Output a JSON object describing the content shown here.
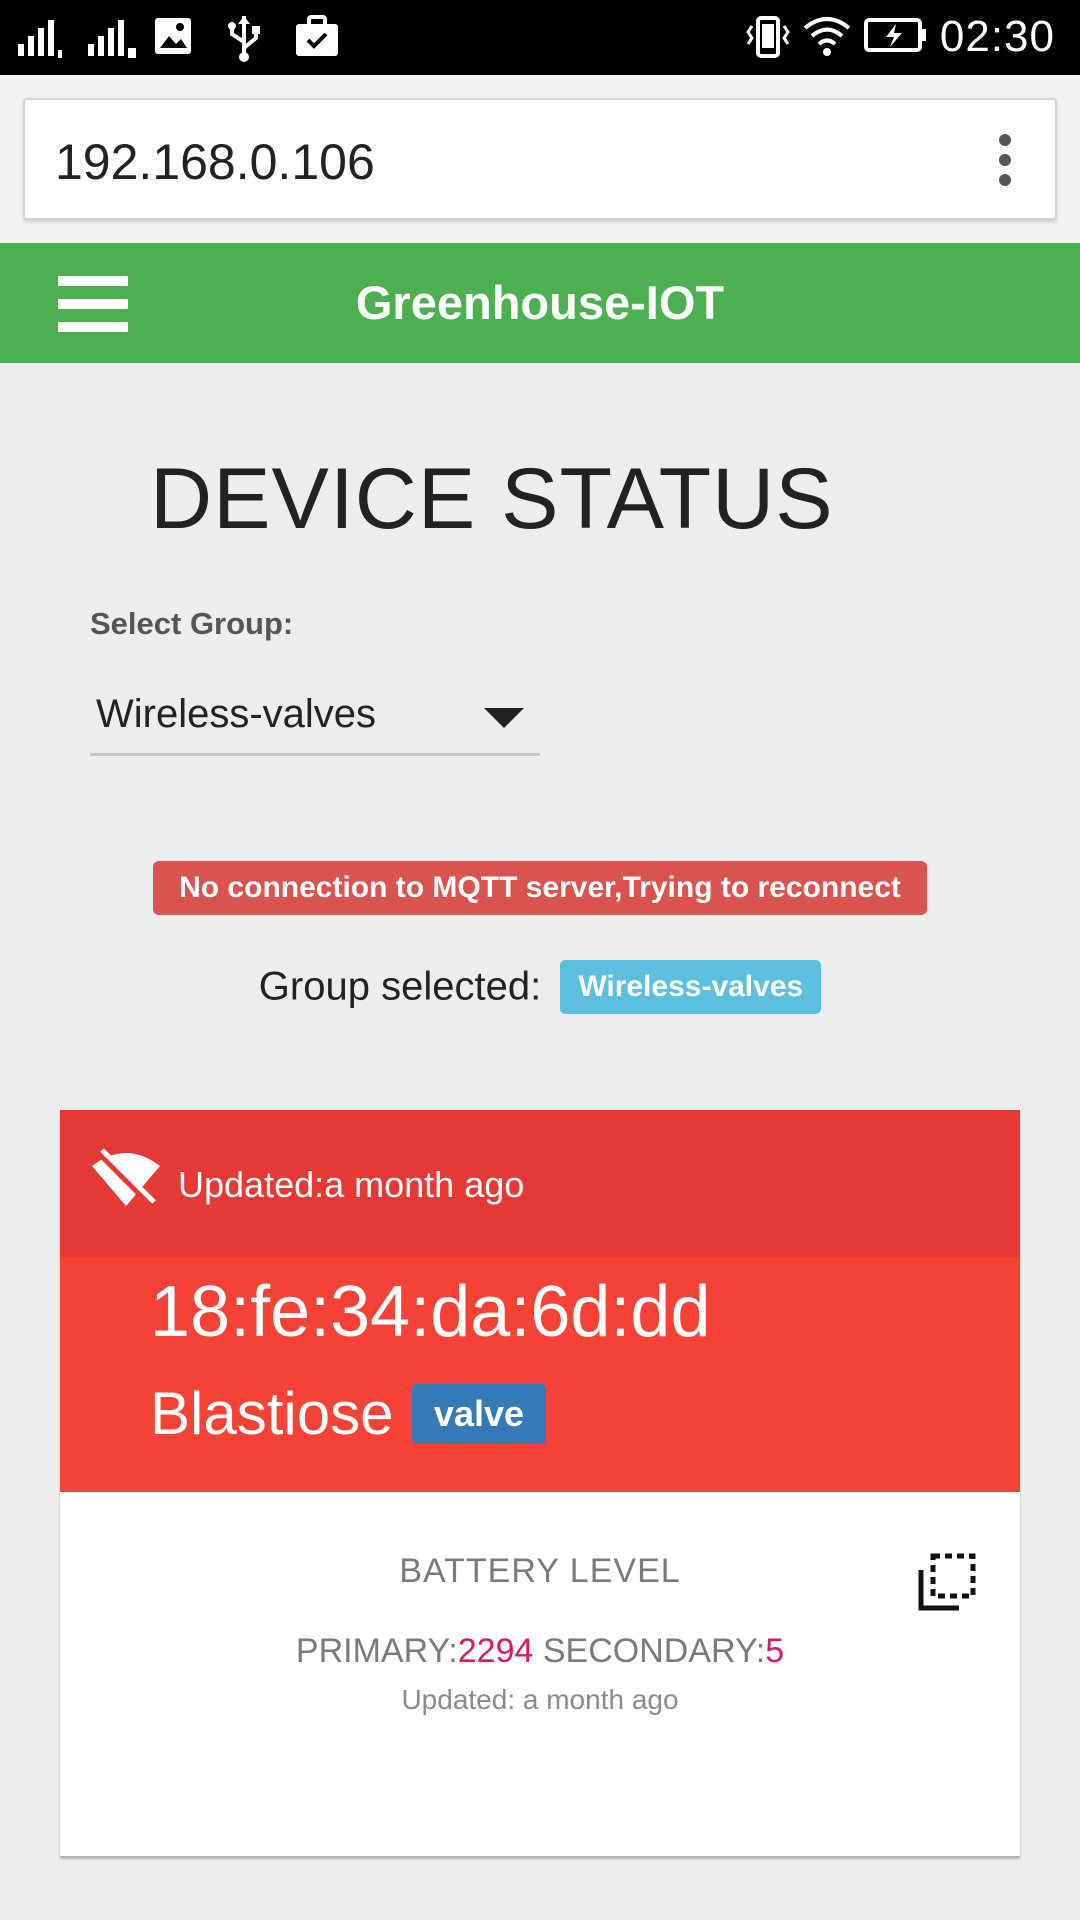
{
  "status_bar": {
    "time": "02:30",
    "icons": [
      "signal-1-icon",
      "signal-2-icon",
      "image-icon",
      "usb-icon",
      "briefcase-check-icon",
      "vibrate-icon",
      "wifi-icon",
      "battery-charging-icon"
    ]
  },
  "browser": {
    "url": "192.168.0.106",
    "menu_icon": "more-vert-icon"
  },
  "app_nav": {
    "title": "Greenhouse-IOT",
    "menu_icon": "hamburger-menu-icon",
    "color": "#4caf50"
  },
  "main": {
    "title": "DEVICE STATUS",
    "select_label": "Select Group:",
    "select_value": "Wireless-valves",
    "alert": "No connection to MQTT server,Trying to reconnect",
    "group_selected_label": "Group selected:",
    "group_selected_badge": "Wireless-valves"
  },
  "device_card": {
    "status_icon": "wifi-off-icon",
    "updated": "Updated:a month ago",
    "mac": "18:fe:34:da:6d:dd",
    "name": "Blastiose",
    "type_badge": "valve",
    "header_color": "#e53935",
    "body_color": "#f44336",
    "battery": {
      "title": "BATTERY LEVEL",
      "primary_label": "PRIMARY:",
      "primary_value": "2294",
      "secondary_label": "SECONDARY:",
      "secondary_value": "5",
      "updated": "Updated: a month ago",
      "flip_icon": "flip-to-back-icon"
    }
  }
}
